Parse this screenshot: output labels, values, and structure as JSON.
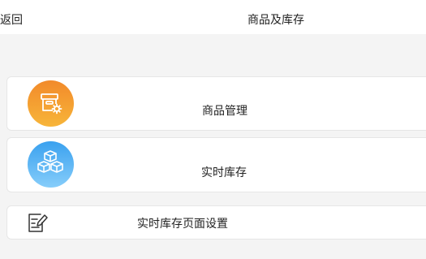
{
  "header": {
    "back_label": "返回",
    "title": "商品及库存"
  },
  "menu": {
    "items": [
      {
        "label": "商品管理",
        "icon": "goods-box-gear-icon"
      },
      {
        "label": "实时库存",
        "icon": "inventory-boxes-icon"
      },
      {
        "label": "实时库存页面设置",
        "icon": "edit-document-icon"
      }
    ]
  },
  "colors": {
    "goods_icon_gradient": [
      "#f28a2a",
      "#f7b53a"
    ],
    "inventory_icon_gradient": [
      "#3aa1ef",
      "#86cdfa"
    ],
    "background": "#f4f4f4"
  }
}
